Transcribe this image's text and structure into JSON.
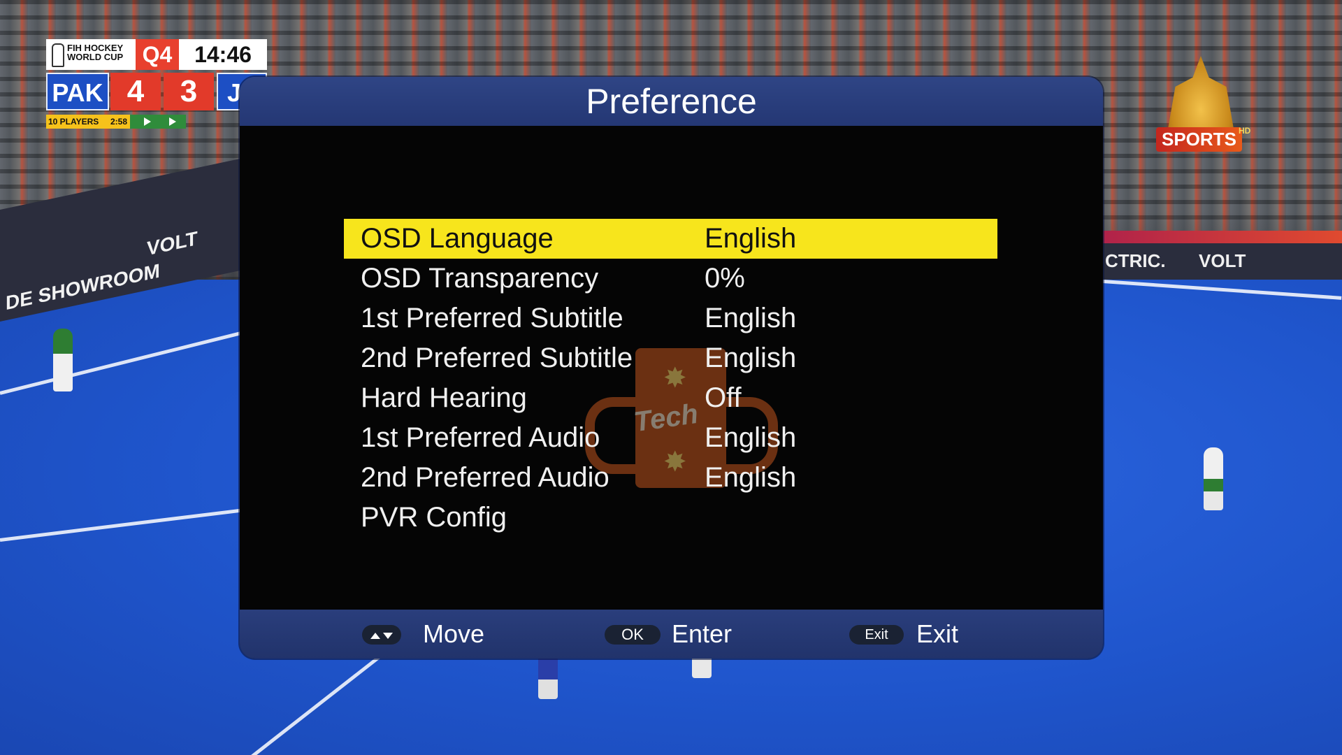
{
  "scoreboard": {
    "event_logo_text": "FIH HOCKEY WORLD CUP",
    "quarter": "Q4",
    "clock": "14:46",
    "home_team": "PAK",
    "home_score": "4",
    "away_score": "3",
    "away_team": "JF",
    "strip_label": "10 PLAYERS",
    "strip_time": "2:58"
  },
  "channel_logo": {
    "text": "SPORTS",
    "suffix": "HD"
  },
  "background_signage": {
    "left_board_1": "DE SHOWROOM",
    "left_board_2": "VOLT",
    "right_board_1": "CTRIC.",
    "right_board_2": "VOLT"
  },
  "dialog": {
    "title": "Preference",
    "items": [
      {
        "label": "OSD Language",
        "value": "English",
        "selected": true
      },
      {
        "label": "OSD Transparency",
        "value": "0%",
        "selected": false
      },
      {
        "label": "1st Preferred Subtitle",
        "value": "English",
        "selected": false
      },
      {
        "label": "2nd Preferred Subtitle",
        "value": "English",
        "selected": false
      },
      {
        "label": "Hard Hearing",
        "value": "Off",
        "selected": false
      },
      {
        "label": "1st Preferred Audio",
        "value": "English",
        "selected": false
      },
      {
        "label": "2nd Preferred Audio",
        "value": "English",
        "selected": false
      },
      {
        "label": "PVR Config",
        "value": "",
        "selected": false
      }
    ],
    "watermark_text": "Tech"
  },
  "footer": {
    "move_key": "▲▼",
    "move_label": "Move",
    "ok_key": "OK",
    "ok_label": "Enter",
    "exit_key": "Exit",
    "exit_label": "Exit"
  },
  "colors": {
    "selected_row": "#f7e51c",
    "dialog_header": "#2f4585",
    "dialog_body": "#050505",
    "pitch_blue": "#1f55cc"
  }
}
